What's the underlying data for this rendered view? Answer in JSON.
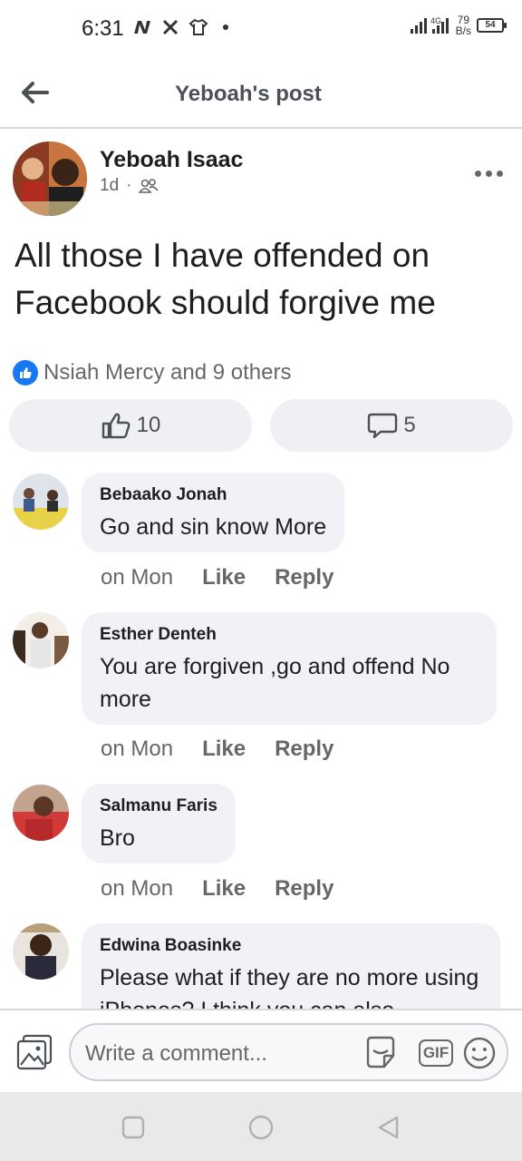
{
  "status_bar": {
    "time": "6:31",
    "net_speed_value": "79",
    "net_speed_unit": "B/s",
    "network_label": "4G",
    "battery": "54"
  },
  "header": {
    "title": "Yeboah's post"
  },
  "post": {
    "author": "Yeboah Isaac",
    "time": "1d",
    "text": "All those I have offended on Facebook should forgive me",
    "reactions_text": "Nsiah Mercy and 9 others",
    "like_count": "10",
    "comment_count": "5"
  },
  "comments": [
    {
      "author": "Bebaako Jonah",
      "text": "Go and sin know More",
      "time": "on Mon",
      "like_label": "Like",
      "reply_label": "Reply"
    },
    {
      "author": "Esther Denteh",
      "text": "You are forgiven ,go and offend No more",
      "time": "on Mon",
      "like_label": "Like",
      "reply_label": "Reply"
    },
    {
      "author": "Salmanu Faris",
      "text": "Bro",
      "time": "on Mon",
      "like_label": "Like",
      "reply_label": "Reply"
    },
    {
      "author": "Edwina Boasinke",
      "text": "Please what if they are no more using iPhones? I think you can also",
      "time": "",
      "like_label": "",
      "reply_label": ""
    }
  ],
  "composer": {
    "placeholder": "Write a comment...",
    "gif_label": "GIF"
  },
  "colors": {
    "brand_blue": "#1877f2",
    "bubble_bg": "#f0f2f5",
    "secondary_text": "#65676b"
  }
}
